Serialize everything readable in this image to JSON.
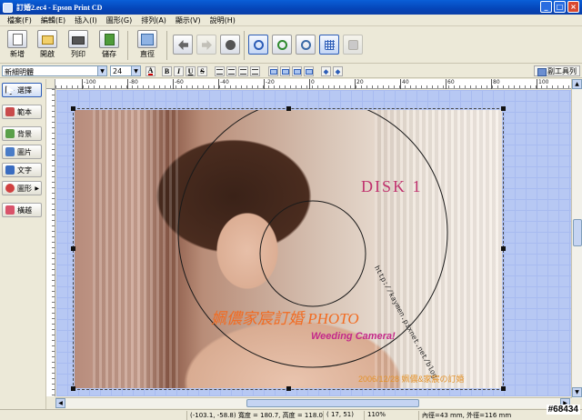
{
  "window": {
    "title": "訂婚2.ec4 - Epson Print CD",
    "minimize": "_",
    "maximize": "□",
    "close": "×"
  },
  "menu": [
    "檔案(F)",
    "編輯(E)",
    "插入(I)",
    "圖形(G)",
    "排列(A)",
    "顯示(V)",
    "說明(H)"
  ],
  "toolbar": {
    "new": "新增",
    "open": "開啟",
    "print": "列印",
    "save": "儲存",
    "straight": "直徑"
  },
  "format": {
    "font": "新細明體",
    "size": "24",
    "bold": "B",
    "italic": "I",
    "underline": "U",
    "strike": "S",
    "subtoolbar": "副工具列"
  },
  "left_tools": [
    "選擇",
    "範本",
    "背景",
    "圖片",
    "文字",
    "圖形",
    "橫越"
  ],
  "ruler": {
    "h_labels": [
      "-100",
      "-80",
      "-60",
      "-40",
      "-20",
      "0",
      "20",
      "40",
      "60",
      "80",
      "100"
    ]
  },
  "canvas": {
    "disk_title": "DISK  1",
    "circle_url": "http://kaymen.pixnet.net/blog",
    "main_title": "姵儂家宸訂婚 PHOTO",
    "sub_title": "Weeding Camera!",
    "date_line": "2006/12/28  姵儂&家宸の訂婚"
  },
  "status": {
    "position": "(-103.1, -58.8) 寬度 = 180.7, 高度 = 118.0",
    "coords": "(   17,  51)",
    "zoom": "110%",
    "diameter": "內徑=43 mm, 外徑=116 mm"
  },
  "watermark": "#68434"
}
